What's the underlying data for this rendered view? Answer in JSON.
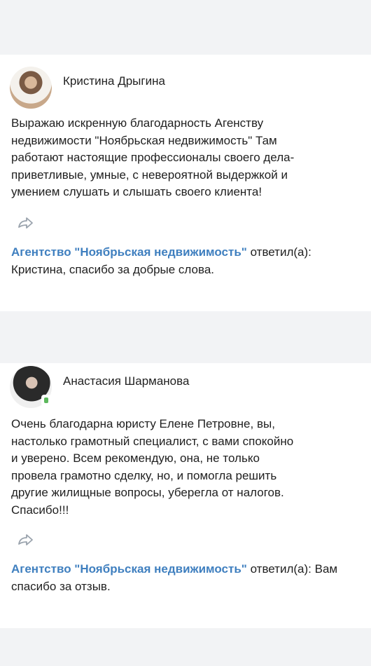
{
  "reviews": [
    {
      "author": "Кристина Дрыгина",
      "text": "Выражаю искренную благодарность Агенству\nнедвижимости \"Ноябрьская недвижимость\" Там\nработают настоящие профессионалы своего дела-\nприветливые, умные, с невероятной выдержкой и\nумением слушать и слышать своего клиента!",
      "reply_author": "Агентство \"Ноябрьская недвижимость\"",
      "reply_verb": "ответил(а):",
      "reply_text": "Кристина, спасибо за добрые слова."
    },
    {
      "author": "Анастасия Шарманова",
      "text": "Очень благодарна юристу Елене Петровне, вы,\nнастолько грамотный специалист, с вами спокойно\nи уверено. Всем рекомендую, она, не только\nпровела грамотно сделку, но, и помогла решить\nдругие жилищные вопросы, уберегла от налогов.\nСпасибо!!!",
      "reply_author": "Агентство \"Ноябрьская недвижимость\"",
      "reply_verb": "ответил(а):",
      "reply_text": "Вам спасибо за отзыв."
    }
  ],
  "icons": {
    "share": "share-icon",
    "online": "online-indicator-icon"
  },
  "colors": {
    "page_background": "#f2f3f5",
    "card_background": "#ffffff",
    "link": "#3f7fbf",
    "text": "#1f1f1f",
    "icon": "#9aa3ad",
    "online": "#5cb85c"
  }
}
